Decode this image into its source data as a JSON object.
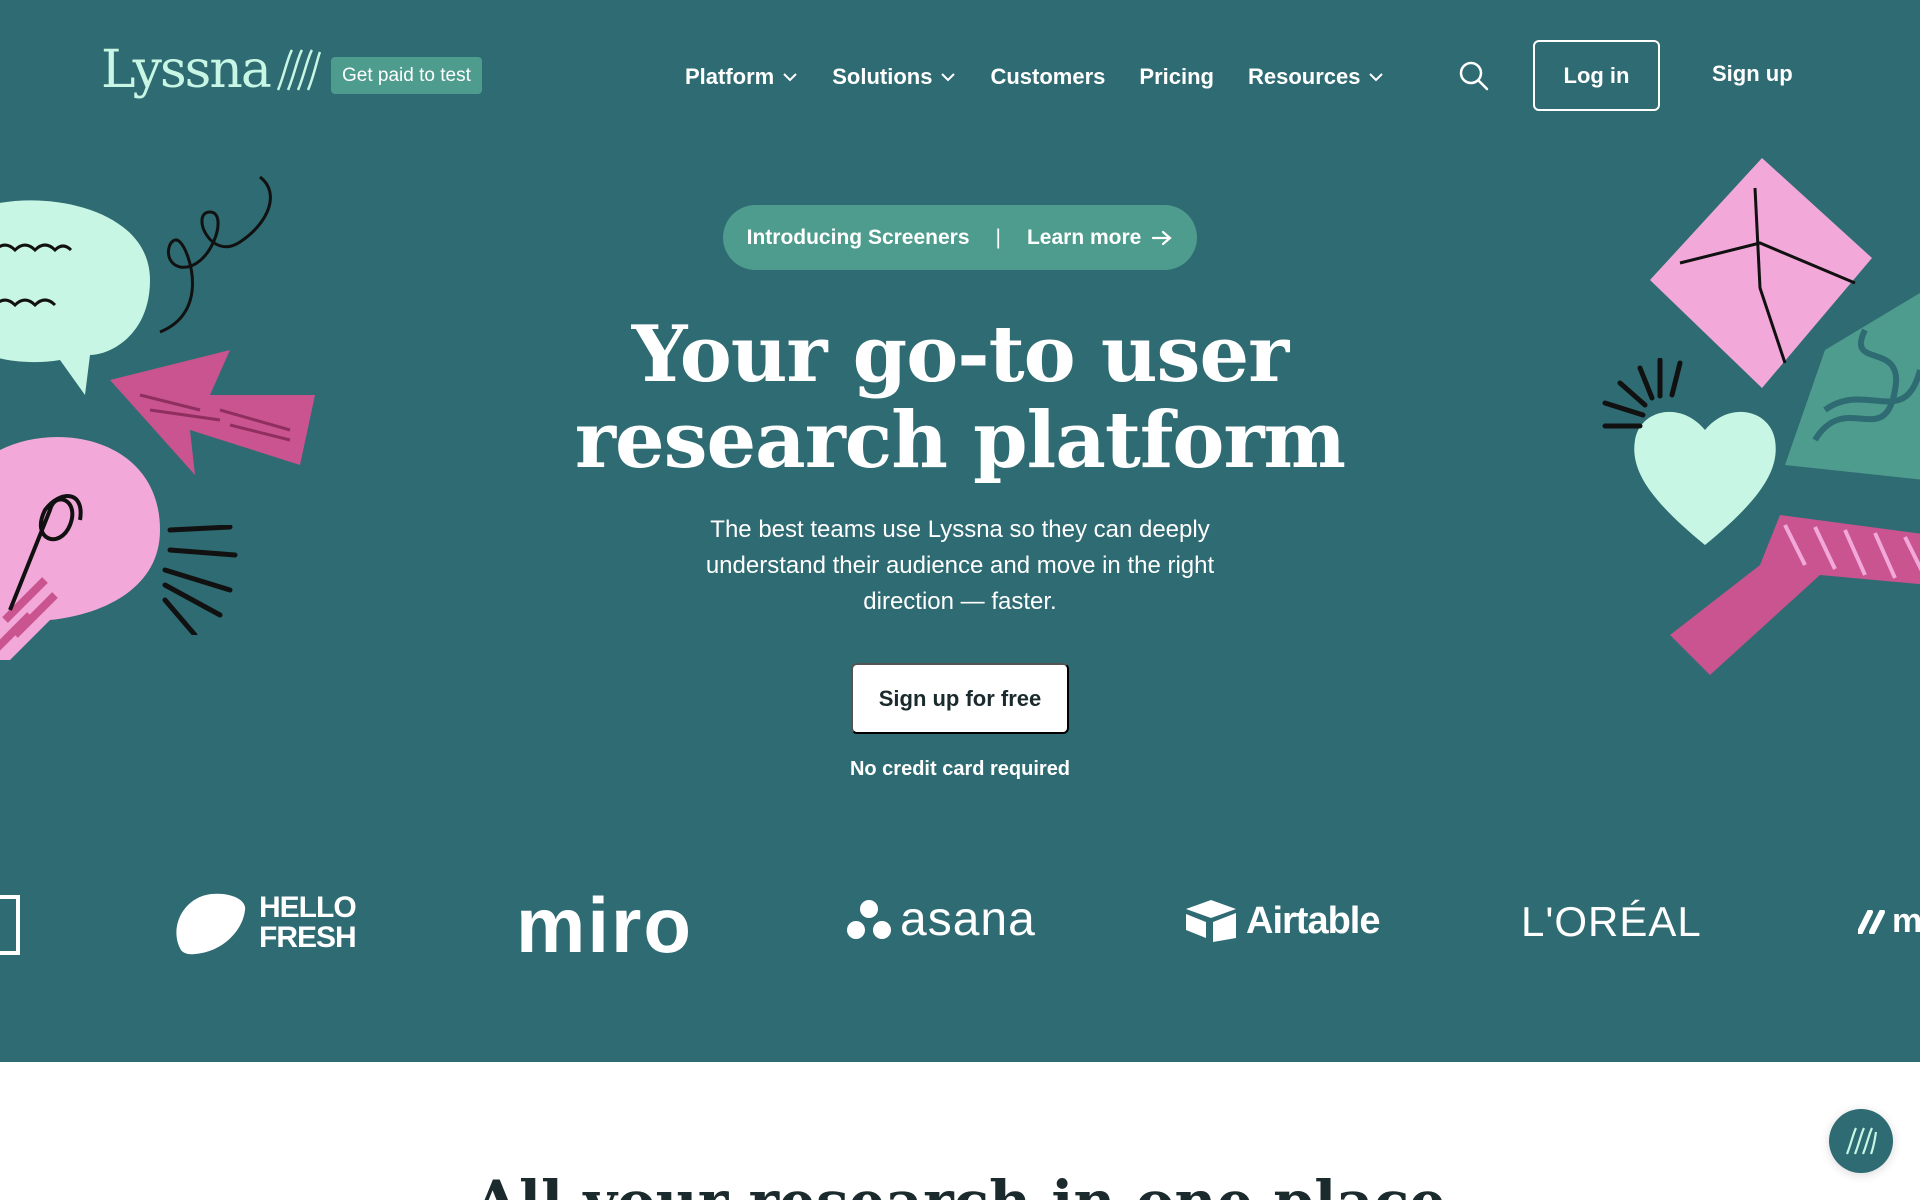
{
  "header": {
    "logo_text": "Lyssna",
    "paid_badge": "Get paid to test",
    "nav": [
      {
        "label": "Platform",
        "dropdown": true
      },
      {
        "label": "Solutions",
        "dropdown": true
      },
      {
        "label": "Customers",
        "dropdown": false
      },
      {
        "label": "Pricing",
        "dropdown": false
      },
      {
        "label": "Resources",
        "dropdown": true
      }
    ],
    "login_label": "Log in",
    "signup_label": "Sign up"
  },
  "announcement": {
    "intro": "Introducing Screeners",
    "separator": "|",
    "learn_more": "Learn more"
  },
  "hero": {
    "headline_line1": "Your go-to user",
    "headline_line2": "research platform",
    "subtext": "The best teams use Lyssna so they can deeply understand their audience and move in the right direction — faster.",
    "cta_label": "Sign up for free",
    "cta_note": "No credit card required"
  },
  "logos": {
    "hellofresh_line1": "HELLO",
    "hellofresh_line2": "FRESH",
    "miro": "miro",
    "asana": "asana",
    "airtable": "Airtable",
    "loreal": "L'ORÉAL",
    "partial_right": "m"
  },
  "section": {
    "title": "All your research in one place"
  },
  "colors": {
    "hero_bg": "#2f6b72",
    "mint": "#c8f6e4",
    "teal_accent": "#4e9c8d",
    "pink": "#f2a9d9",
    "magenta": "#c9548f"
  },
  "icons": {
    "search": "search-icon",
    "chevron": "chevron-down-icon",
    "arrow": "arrow-right-icon",
    "chat": "lyssna-chat-icon"
  }
}
